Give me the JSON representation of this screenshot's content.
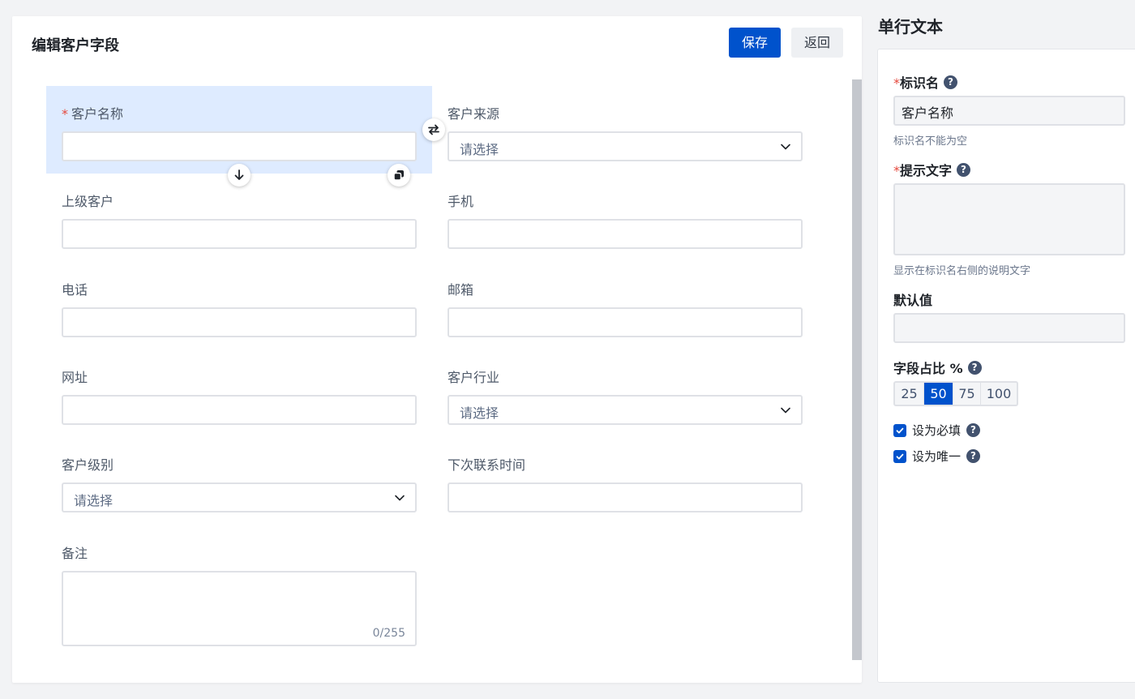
{
  "editor": {
    "title": "编辑客户字段",
    "save_label": "保存",
    "back_label": "返回"
  },
  "fields": {
    "customer_name": {
      "label": "客户名称",
      "required": "*",
      "value": ""
    },
    "customer_source": {
      "label": "客户来源",
      "placeholder": "请选择"
    },
    "parent_customer": {
      "label": "上级客户",
      "value": ""
    },
    "mobile": {
      "label": "手机",
      "value": ""
    },
    "phone": {
      "label": "电话",
      "value": ""
    },
    "email": {
      "label": "邮箱",
      "value": ""
    },
    "website": {
      "label": "网址",
      "value": ""
    },
    "industry": {
      "label": "客户行业",
      "placeholder": "请选择"
    },
    "level": {
      "label": "客户级别",
      "placeholder": "请选择"
    },
    "next_contact": {
      "label": "下次联系时间",
      "value": ""
    },
    "remark": {
      "label": "备注",
      "counter": "0/255"
    }
  },
  "panel": {
    "title": "单行文本",
    "label_name": {
      "label": "标识名",
      "required": "*",
      "value": "客户名称",
      "hint": "标识名不能为空"
    },
    "tip_text": {
      "label": "提示文字",
      "required": "*",
      "hint": "显示在标识名右侧的说明文字"
    },
    "default_value": {
      "label": "默认值",
      "value": ""
    },
    "width_ratio": {
      "label": "字段占比 %",
      "options": [
        "25",
        "50",
        "75",
        "100"
      ],
      "selected": "50"
    },
    "required_check": {
      "label": "设为必填",
      "checked": true
    },
    "unique_check": {
      "label": "设为唯一",
      "checked": true
    }
  },
  "colors": {
    "primary": "#0052cc",
    "selected_bg": "#deebff",
    "required": "#e5483d"
  },
  "icons": {
    "swap": "swap-icon",
    "move_down": "arrow-down-icon",
    "copy": "copy-icon",
    "chevron": "chevron-down-icon",
    "help": "help-icon",
    "check": "check-icon"
  }
}
